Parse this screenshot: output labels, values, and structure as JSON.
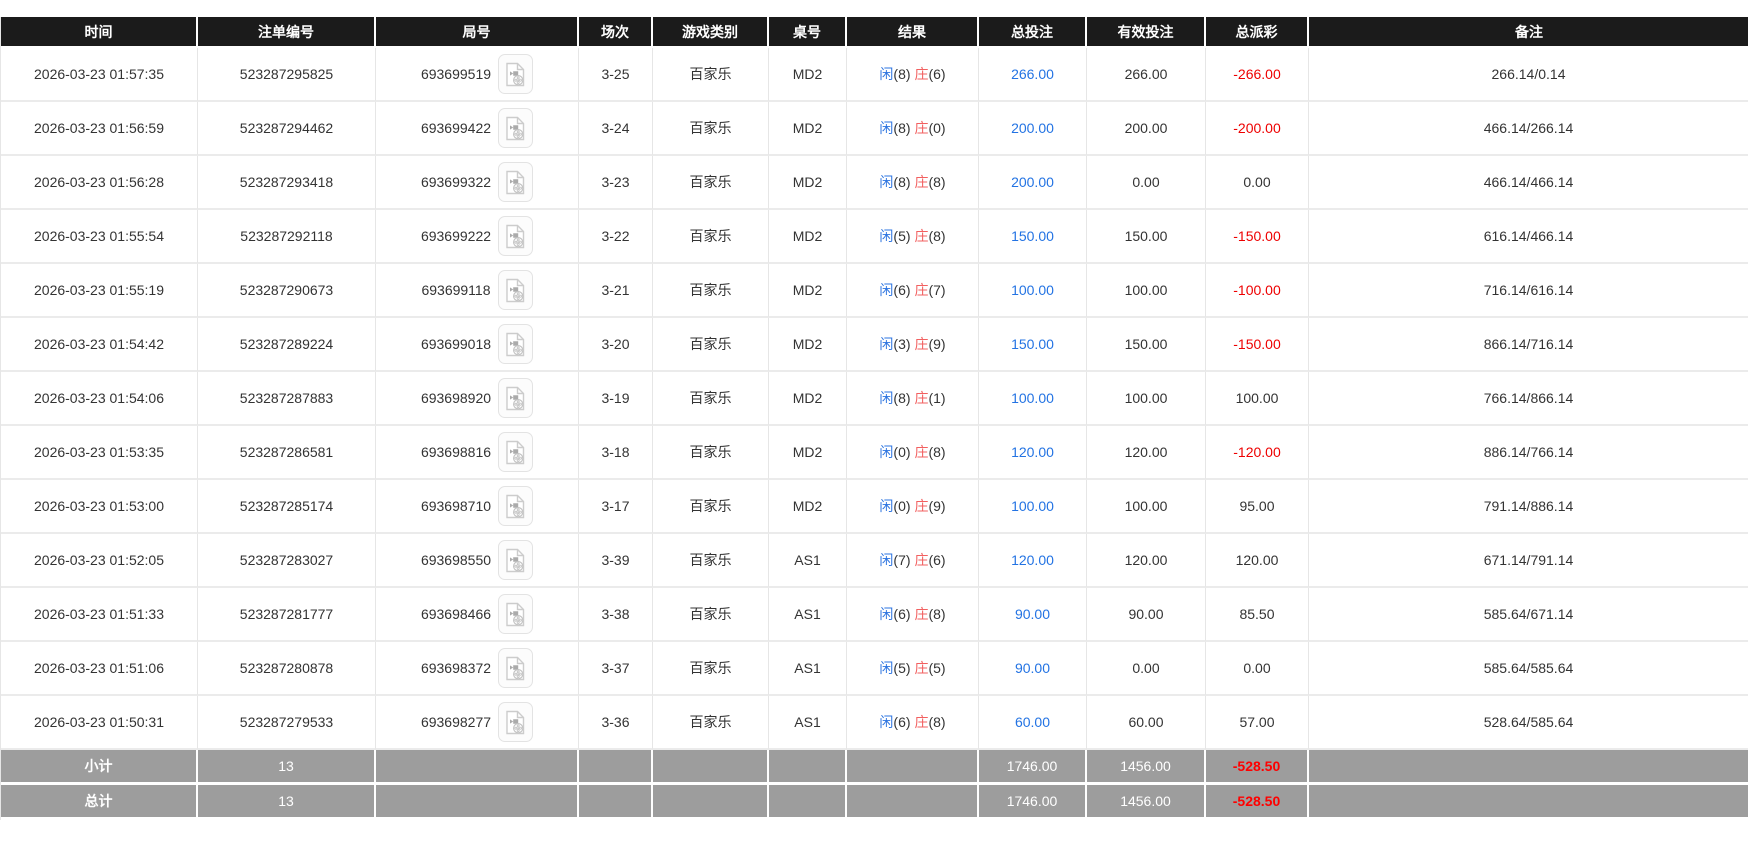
{
  "table": {
    "columns": [
      "时间",
      "注单编号",
      "局号",
      "场次",
      "游戏类别",
      "桌号",
      "结果",
      "总投注",
      "有效投注",
      "总派彩",
      "备注"
    ],
    "rows": [
      {
        "time": "2026-03-23 01:57:35",
        "order_id": "523287295825",
        "round_id": "693699519",
        "session": "3-25",
        "game": "百家乐",
        "table_id": "MD2",
        "player_label": "闲",
        "player_score": "(8)",
        "banker_label": "庄",
        "banker_score": "(6)",
        "total_bet": "266.00",
        "valid_bet": "266.00",
        "payout": "-266.00",
        "remark": "266.14/0.14"
      },
      {
        "time": "2026-03-23 01:56:59",
        "order_id": "523287294462",
        "round_id": "693699422",
        "session": "3-24",
        "game": "百家乐",
        "table_id": "MD2",
        "player_label": "闲",
        "player_score": "(8)",
        "banker_label": "庄",
        "banker_score": "(0)",
        "total_bet": "200.00",
        "valid_bet": "200.00",
        "payout": "-200.00",
        "remark": "466.14/266.14"
      },
      {
        "time": "2026-03-23 01:56:28",
        "order_id": "523287293418",
        "round_id": "693699322",
        "session": "3-23",
        "game": "百家乐",
        "table_id": "MD2",
        "player_label": "闲",
        "player_score": "(8)",
        "banker_label": "庄",
        "banker_score": "(8)",
        "total_bet": "200.00",
        "valid_bet": "0.00",
        "payout": "0.00",
        "remark": "466.14/466.14"
      },
      {
        "time": "2026-03-23 01:55:54",
        "order_id": "523287292118",
        "round_id": "693699222",
        "session": "3-22",
        "game": "百家乐",
        "table_id": "MD2",
        "player_label": "闲",
        "player_score": "(5)",
        "banker_label": "庄",
        "banker_score": "(8)",
        "total_bet": "150.00",
        "valid_bet": "150.00",
        "payout": "-150.00",
        "remark": "616.14/466.14"
      },
      {
        "time": "2026-03-23 01:55:19",
        "order_id": "523287290673",
        "round_id": "693699118",
        "session": "3-21",
        "game": "百家乐",
        "table_id": "MD2",
        "player_label": "闲",
        "player_score": "(6)",
        "banker_label": "庄",
        "banker_score": "(7)",
        "total_bet": "100.00",
        "valid_bet": "100.00",
        "payout": "-100.00",
        "remark": "716.14/616.14"
      },
      {
        "time": "2026-03-23 01:54:42",
        "order_id": "523287289224",
        "round_id": "693699018",
        "session": "3-20",
        "game": "百家乐",
        "table_id": "MD2",
        "player_label": "闲",
        "player_score": "(3)",
        "banker_label": "庄",
        "banker_score": "(9)",
        "total_bet": "150.00",
        "valid_bet": "150.00",
        "payout": "-150.00",
        "remark": "866.14/716.14"
      },
      {
        "time": "2026-03-23 01:54:06",
        "order_id": "523287287883",
        "round_id": "693698920",
        "session": "3-19",
        "game": "百家乐",
        "table_id": "MD2",
        "player_label": "闲",
        "player_score": "(8)",
        "banker_label": "庄",
        "banker_score": "(1)",
        "total_bet": "100.00",
        "valid_bet": "100.00",
        "payout": "100.00",
        "remark": "766.14/866.14"
      },
      {
        "time": "2026-03-23 01:53:35",
        "order_id": "523287286581",
        "round_id": "693698816",
        "session": "3-18",
        "game": "百家乐",
        "table_id": "MD2",
        "player_label": "闲",
        "player_score": "(0)",
        "banker_label": "庄",
        "banker_score": "(8)",
        "total_bet": "120.00",
        "valid_bet": "120.00",
        "payout": "-120.00",
        "remark": "886.14/766.14"
      },
      {
        "time": "2026-03-23 01:53:00",
        "order_id": "523287285174",
        "round_id": "693698710",
        "session": "3-17",
        "game": "百家乐",
        "table_id": "MD2",
        "player_label": "闲",
        "player_score": "(0)",
        "banker_label": "庄",
        "banker_score": "(9)",
        "total_bet": "100.00",
        "valid_bet": "100.00",
        "payout": "95.00",
        "remark": "791.14/886.14"
      },
      {
        "time": "2026-03-23 01:52:05",
        "order_id": "523287283027",
        "round_id": "693698550",
        "session": "3-39",
        "game": "百家乐",
        "table_id": "AS1",
        "player_label": "闲",
        "player_score": "(7)",
        "banker_label": "庄",
        "banker_score": "(6)",
        "total_bet": "120.00",
        "valid_bet": "120.00",
        "payout": "120.00",
        "remark": "671.14/791.14"
      },
      {
        "time": "2026-03-23 01:51:33",
        "order_id": "523287281777",
        "round_id": "693698466",
        "session": "3-38",
        "game": "百家乐",
        "table_id": "AS1",
        "player_label": "闲",
        "player_score": "(6)",
        "banker_label": "庄",
        "banker_score": "(8)",
        "total_bet": "90.00",
        "valid_bet": "90.00",
        "payout": "85.50",
        "remark": "585.64/671.14"
      },
      {
        "time": "2026-03-23 01:51:06",
        "order_id": "523287280878",
        "round_id": "693698372",
        "session": "3-37",
        "game": "百家乐",
        "table_id": "AS1",
        "player_label": "闲",
        "player_score": "(5)",
        "banker_label": "庄",
        "banker_score": "(5)",
        "total_bet": "90.00",
        "valid_bet": "0.00",
        "payout": "0.00",
        "remark": "585.64/585.64"
      },
      {
        "time": "2026-03-23 01:50:31",
        "order_id": "523287279533",
        "round_id": "693698277",
        "session": "3-36",
        "game": "百家乐",
        "table_id": "AS1",
        "player_label": "闲",
        "player_score": "(6)",
        "banker_label": "庄",
        "banker_score": "(8)",
        "total_bet": "60.00",
        "valid_bet": "60.00",
        "payout": "57.00",
        "remark": "528.64/585.64"
      }
    ],
    "footer": {
      "subtotal": {
        "label": "小计",
        "count": "13",
        "total_bet": "1746.00",
        "valid_bet": "1456.00",
        "payout": "-528.50"
      },
      "total": {
        "label": "总计",
        "count": "13",
        "total_bet": "1746.00",
        "valid_bet": "1456.00",
        "payout": "-528.50"
      }
    }
  },
  "icons": {
    "video_replay": "video-file-icon"
  },
  "colors": {
    "header_bg": "#1b1b1b",
    "footer_bg": "#9d9d9d",
    "bet_link_blue": "#2373e3",
    "player_blue": "#2c74e0",
    "banker_red": "#f26060",
    "negative_red": "#ee0000",
    "footer_negative_red": "#ff0000"
  }
}
